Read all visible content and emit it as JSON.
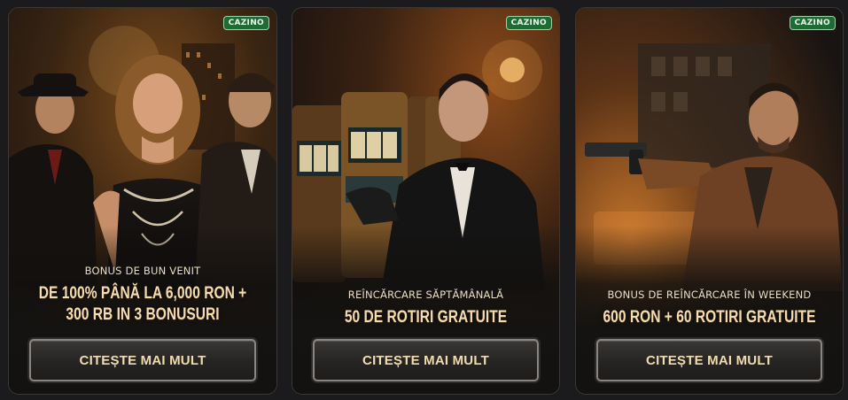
{
  "cards": [
    {
      "badge": "CAZINO",
      "subtitle": "BONUS DE BUN VENIT",
      "headline_line1": "DE 100% PÂNĂ LA 6,000 RON +",
      "headline_line2": "300 RB IN 3 BONUSURI",
      "cta": "CITEȘTE MAI MULT"
    },
    {
      "badge": "CAZINO",
      "subtitle": "REÎNCĂRCARE SĂPTĂMÂNALĂ",
      "headline_line1": "50 DE ROTIRI GRATUITE",
      "cta": "CITEȘTE MAI MULT"
    },
    {
      "badge": "CAZINO",
      "subtitle": "BONUS DE REÎNCĂRCARE ÎN WEEKEND",
      "headline_line1": "600 RON + 60 ROTIRI GRATUITE",
      "cta": "CITEȘTE MAI MULT"
    }
  ],
  "colors": {
    "badge_bg": "#1e6b34",
    "headline_gold": "#f4dcae",
    "cta_border": "#8a8580"
  }
}
